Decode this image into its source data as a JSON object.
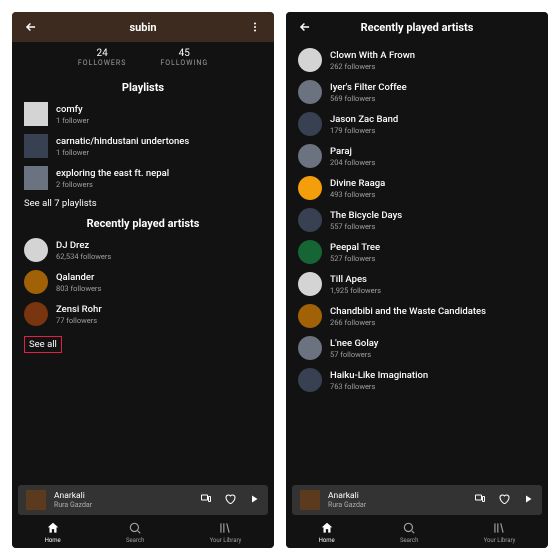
{
  "left": {
    "header_title": "subin",
    "stats": {
      "followers_count": "24",
      "followers_label": "FOLLOWERS",
      "following_count": "45",
      "following_label": "FOLLOWING"
    },
    "playlists_heading": "Playlists",
    "playlists": [
      {
        "name": "comfy",
        "sub": "1 follower"
      },
      {
        "name": "carnatic/hindustani undertones",
        "sub": "1 follower"
      },
      {
        "name": "exploring the east ft. nepal",
        "sub": "2 followers"
      }
    ],
    "see_all_playlists": "See all 7 playlists",
    "artists_heading": "Recently played artists",
    "artists": [
      {
        "name": "DJ Drez",
        "sub": "62,534 followers"
      },
      {
        "name": "Qalander",
        "sub": "803 followers"
      },
      {
        "name": "Zensi Rohr",
        "sub": "77 followers"
      }
    ],
    "see_all": "See all"
  },
  "right": {
    "header_title": "Recently played artists",
    "artists": [
      {
        "name": "Clown With A Frown",
        "sub": "262 followers"
      },
      {
        "name": "Iyer's Filter Coffee",
        "sub": "569 followers"
      },
      {
        "name": "Jason Zac Band",
        "sub": "179 followers"
      },
      {
        "name": "Paraj",
        "sub": "204 followers"
      },
      {
        "name": "Divine Raaga",
        "sub": "493 followers"
      },
      {
        "name": "The Bicycle Days",
        "sub": "557 followers"
      },
      {
        "name": "Peepal Tree",
        "sub": "527 followers"
      },
      {
        "name": "Till Apes",
        "sub": "1,925 followers"
      },
      {
        "name": "Chandbibi and the Waste Candidates",
        "sub": "266 followers"
      },
      {
        "name": "L'nee Golay",
        "sub": "57 followers"
      },
      {
        "name": "Haiku-Like Imagination",
        "sub": "763 followers"
      }
    ]
  },
  "player": {
    "title": "Anarkali",
    "artist": "Rura Gazdar"
  },
  "nav": {
    "home": "Home",
    "search": "Search",
    "library": "Your Library"
  }
}
